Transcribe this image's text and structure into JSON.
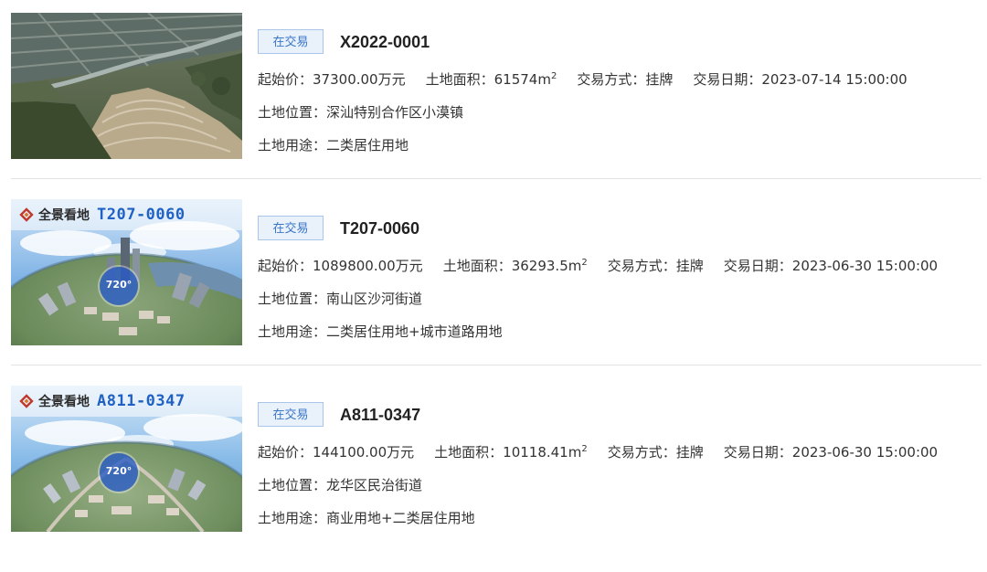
{
  "labels": {
    "start_price": "起始价：",
    "area": "土地面积：",
    "trade_mode": "交易方式：",
    "trade_date": "交易日期：",
    "location": "土地位置：",
    "usage": "土地用途：",
    "area_unit_base": "m",
    "area_unit_exp": "2"
  },
  "colors": {
    "status_bg": "#e9f1fb",
    "status_border": "#a9c5ea",
    "status_text": "#3a76c8",
    "pano_code": "#1f61c4",
    "separator": "#e3e3e3"
  },
  "listings": [
    {
      "status": "在交易",
      "code": "X2022-0001",
      "thumbnail": "aerial-wetland-photo",
      "start_price": "37300.00万元",
      "area": "61574",
      "trade_mode": "挂牌",
      "trade_date": "2023-07-14 15:00:00",
      "location": "深汕特别合作区小漠镇",
      "usage": "二类居住用地"
    },
    {
      "status": "在交易",
      "code": "T207-0060",
      "thumbnail": "panorama-city-photo",
      "pano_brand": "全景看地",
      "pano_code": "T207-0060",
      "badge": "720°",
      "start_price": "1089800.00万元",
      "area": "36293.5",
      "trade_mode": "挂牌",
      "trade_date": "2023-06-30 15:00:00",
      "location": "南山区沙河街道",
      "usage": "二类居住用地+城市道路用地"
    },
    {
      "status": "在交易",
      "code": "A811-0347",
      "thumbnail": "panorama-city-photo",
      "pano_brand": "全景看地",
      "pano_code": "A811-0347",
      "badge": "720°",
      "start_price": "144100.00万元",
      "area": "10118.41",
      "trade_mode": "挂牌",
      "trade_date": "2023-06-30 15:00:00",
      "location": "龙华区民治街道",
      "usage": "商业用地+二类居住用地"
    }
  ]
}
